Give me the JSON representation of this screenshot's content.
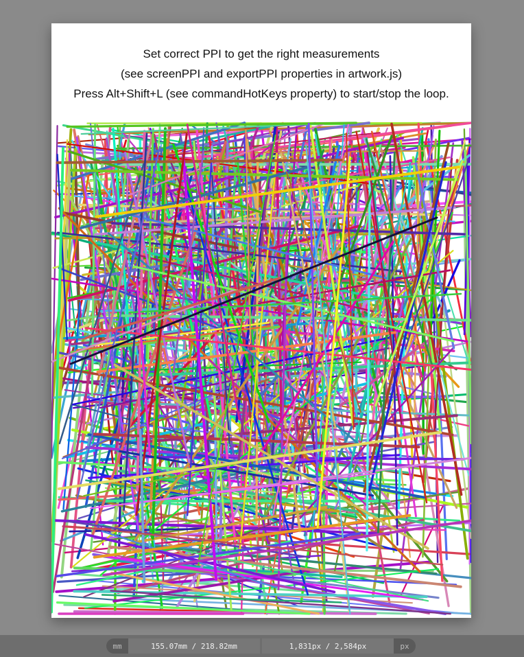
{
  "artwork": {
    "instructions": [
      "Set correct PPI to get the right measurements",
      "(see screenPPI and exportPPI properties in artwork.js)",
      "Press Alt+Shift+L (see commandHotKeys property) to start/stop the loop."
    ],
    "background_color": "#ffffff"
  },
  "statusbar": {
    "unit_mm_label": "mm",
    "size_mm": "155.07mm / 218.82mm",
    "size_px": "1,831px / 2,584px",
    "unit_px_label": "px"
  },
  "colors": {
    "stage_bg": "#8a8a8a",
    "statusbar_bg": "#6e6e6e"
  }
}
